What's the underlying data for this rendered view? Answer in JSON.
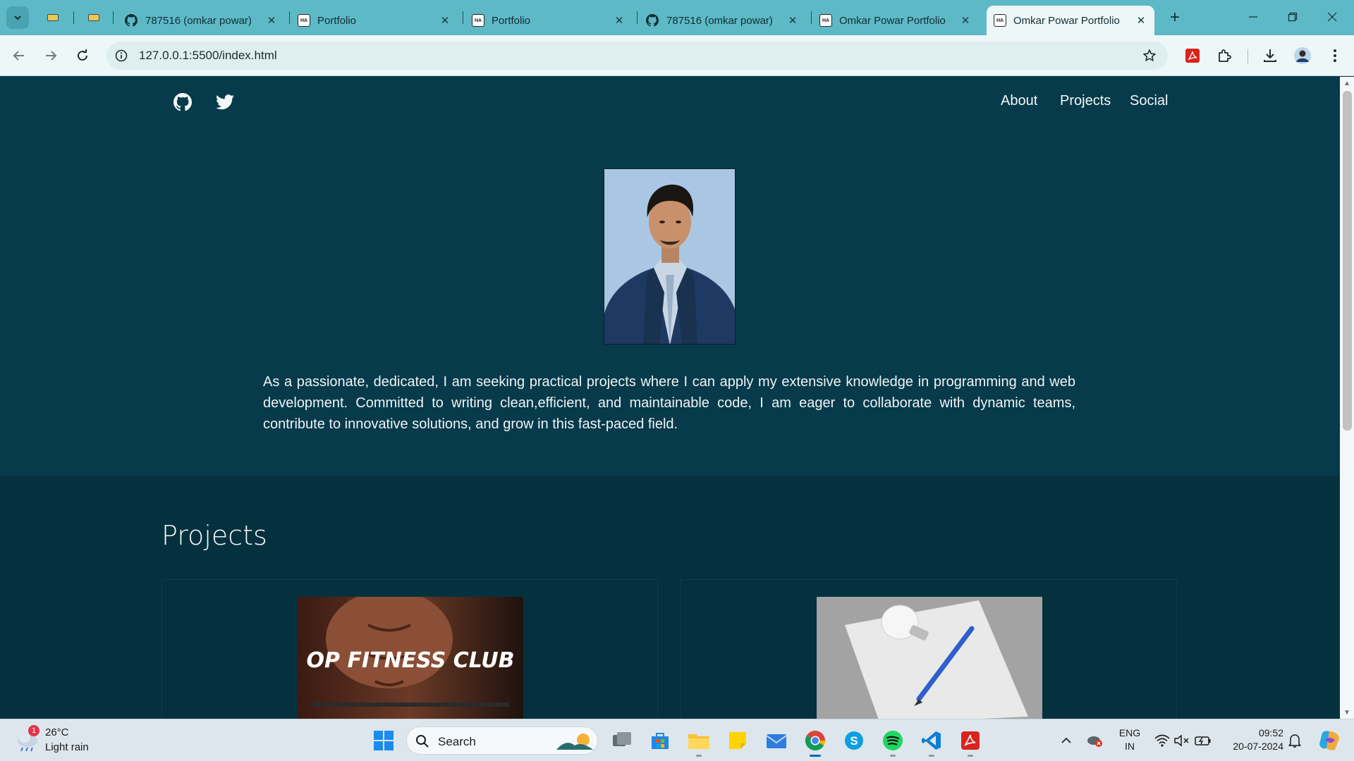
{
  "browser": {
    "tabs": [
      {
        "title": "787516 (omkar powar)",
        "icon": "github-icon"
      },
      {
        "title": "Portfolio",
        "icon": "ha-favicon"
      },
      {
        "title": "Portfolio",
        "icon": "ha-favicon"
      },
      {
        "title": "787516 (omkar powar)",
        "icon": "github-icon"
      },
      {
        "title": "Omkar Powar Portfolio",
        "icon": "ha-favicon"
      },
      {
        "title": "Omkar Powar Portfolio",
        "icon": "ha-favicon",
        "active": true
      }
    ],
    "favicon_text": "HA",
    "url": "127.0.0.1:5500/index.html"
  },
  "page": {
    "nav": {
      "about": "About",
      "projects": "Projects",
      "social": "Social"
    },
    "bio": "As a passionate, dedicated, I am seeking practical projects where I can apply my extensive knowledge in programming and web development. Committed to writing clean,efficient, and maintainable code, I am eager to collaborate with dynamic teams, contribute to innovative solutions, and grow in this fast-paced field.",
    "projects": {
      "heading": "Projects",
      "cards": [
        {
          "image_text": "OP FITNESS CLUB"
        },
        {
          "image_text": ""
        }
      ]
    }
  },
  "taskbar": {
    "weather": {
      "temp": "26°C",
      "desc": "Light rain",
      "badge": "1"
    },
    "search_label": "Search",
    "lang_line1": "ENG",
    "lang_line2": "IN",
    "time": "09:52",
    "date": "20-07-2024"
  },
  "colors": {
    "tabstrip": "#5eb9c6",
    "page_bg": "#073a4a",
    "projects_bg": "#05313f",
    "accent": "#0067c0"
  }
}
